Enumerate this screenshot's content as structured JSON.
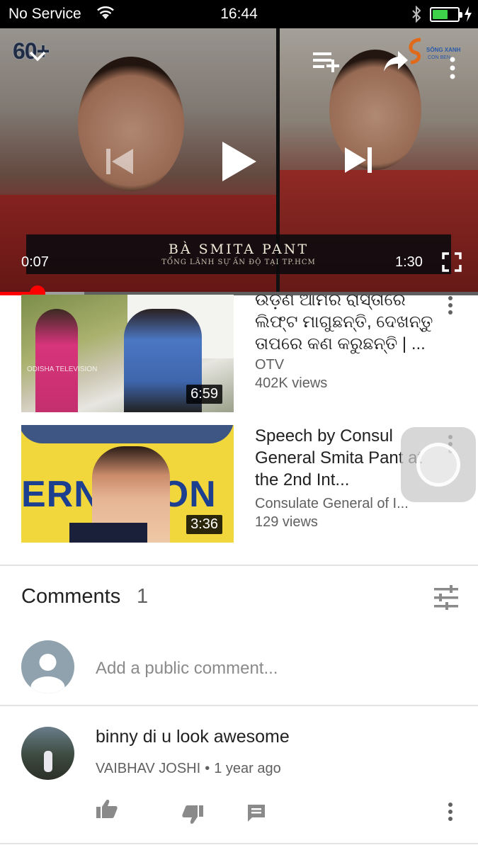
{
  "status_bar": {
    "carrier": "No Service",
    "time": "16:44",
    "battery_level": 0.62,
    "battery_color": "#3ed24a"
  },
  "player": {
    "watermark": "60+",
    "caption_name": "BÀ SMITA PANT",
    "caption_subtitle": "TỔNG LÃNH SỰ ẤN ĐỘ TẠI TP.HCM",
    "sponsor_text": "SÔNG XANH",
    "sponsor_text2": "CON BEN",
    "current_time": "0:07",
    "duration": "1:30",
    "progress_fraction": 0.078,
    "buffer_fraction": 0.176,
    "accent_color": "#ff0000",
    "icons": [
      "collapse-icon",
      "add-to-queue-icon",
      "share-icon",
      "more-vert-icon",
      "previous-icon",
      "play-icon",
      "next-icon",
      "fullscreen-icon"
    ]
  },
  "related": [
    {
      "title": "ଉଡ଼ଣ ଆମର ରାସ୍ତାରେ ଲିଫ୍ଟ ମାଗୁଛନ୍ତି, ଦେଖନ୍ତୁ ତାପରେ କଣ କରୁଛନ୍ତି | ...",
      "channel": "OTV",
      "views": "402K views",
      "duration": "6:59",
      "thumb_watermark": "ODISHA TELEVISION"
    },
    {
      "title": "Speech by Consul General Smita Pant at the 2nd Int...",
      "channel": "Consulate General of I...",
      "views": "129 views",
      "duration": "3:36",
      "thumb_banner": "ERNATION"
    }
  ],
  "comments": {
    "heading": "Comments",
    "count": "1",
    "add_placeholder": "Add a public comment...",
    "items": [
      {
        "text": "binny di u look awesome",
        "author": "VAIBHAV JOSHI",
        "separator": "•",
        "time": "1 year ago"
      }
    ]
  }
}
